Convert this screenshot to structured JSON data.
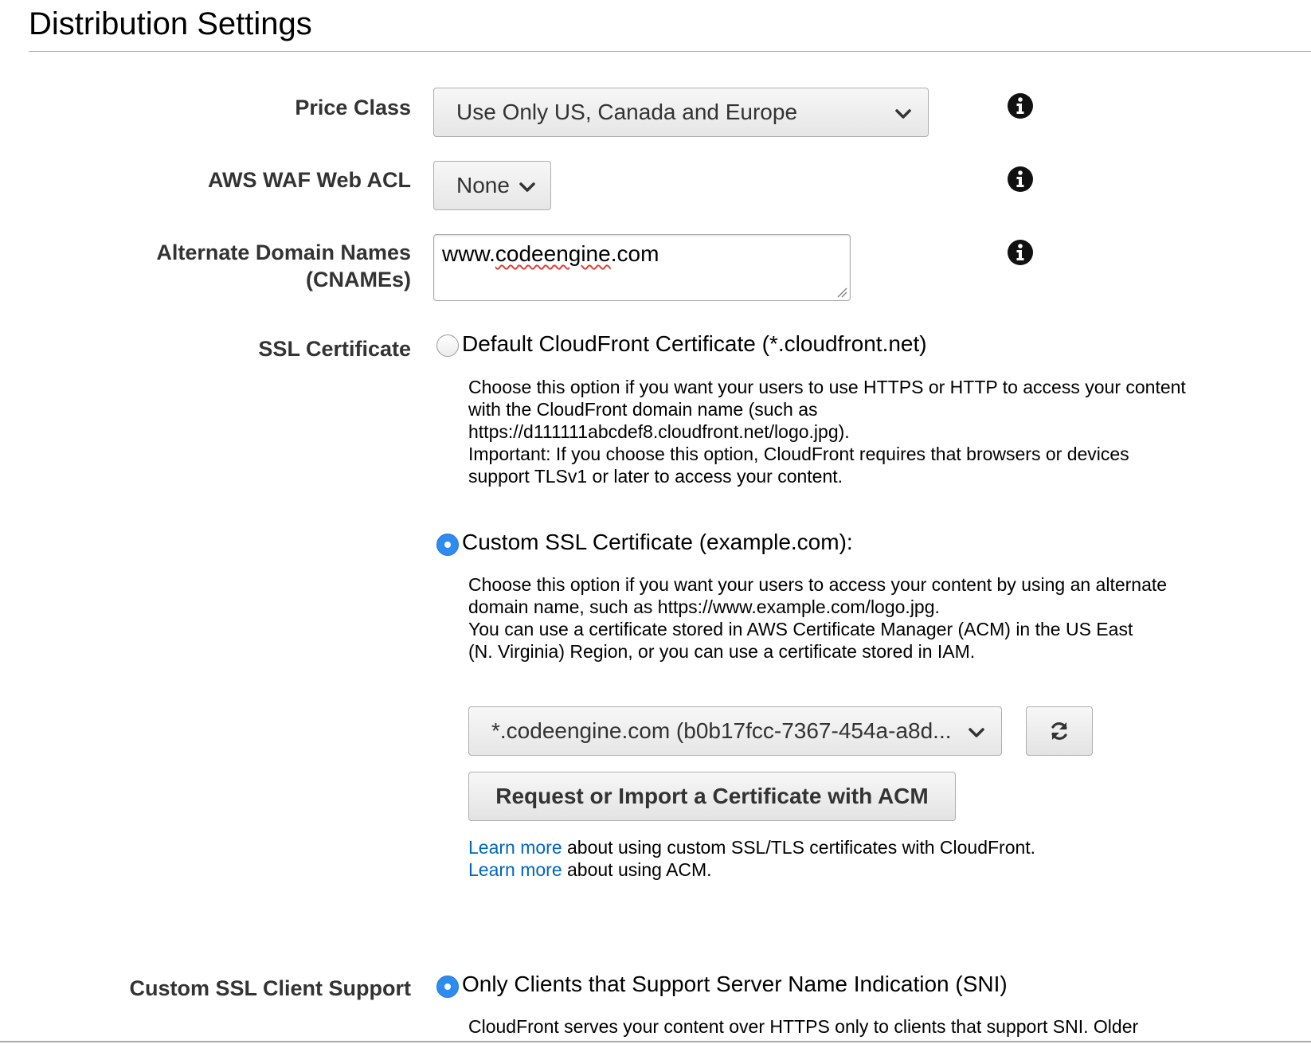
{
  "header": {
    "title": "Distribution Settings"
  },
  "price_class": {
    "label": "Price Class",
    "selected": "Use Only US, Canada and Europe"
  },
  "waf": {
    "label": "AWS WAF Web ACL",
    "selected": "None"
  },
  "cnames": {
    "label_line1": "Alternate Domain Names",
    "label_line2": "(CNAMEs)",
    "value_part1": "www.",
    "value_part2": "codeengine",
    "value_part3": ".com"
  },
  "ssl": {
    "label": "SSL Certificate",
    "default_option": {
      "label": "Default CloudFront Certificate (*.cloudfront.net)",
      "selected": false,
      "description": [
        "Choose this option if you want your users to use HTTPS or HTTP to access your content",
        "with the CloudFront domain name (such as",
        "https://d111111abcdef8.cloudfront.net/logo.jpg).",
        "Important: If you choose this option, CloudFront requires that browsers or devices",
        "support TLSv1 or later to access your content."
      ]
    },
    "custom_option": {
      "label": "Custom SSL Certificate (example.com):",
      "selected": true,
      "description": [
        "Choose this option if you want your users to access your content by using an alternate",
        "domain name, such as https://www.example.com/logo.jpg.",
        "You can use a certificate stored in AWS Certificate Manager (ACM) in the US East",
        "(N. Virginia) Region, or you can use a certificate stored in IAM."
      ],
      "certificate_selected": "*.codeengine.com (b0b17fcc-7367-454a-a8d...",
      "acm_button": "Request or Import a Certificate with ACM",
      "learn_more_1": {
        "link": "Learn more",
        "text": " about using custom SSL/TLS certificates with CloudFront."
      },
      "learn_more_2": {
        "link": "Learn more",
        "text": " about using ACM."
      }
    }
  },
  "client_support": {
    "label": "Custom SSL Client Support",
    "option_label": "Only Clients that Support Server Name Indication (SNI)",
    "selected": true,
    "description_line1": "CloudFront serves your content over HTTPS only to clients that support SNI. Older"
  },
  "icons": {
    "info": "info-icon",
    "dropdown": "chevron-down-icon",
    "refresh": "refresh-icon"
  },
  "colors": {
    "radio_selected": "#2e8cf0",
    "link": "#0066c0",
    "label": "#333333"
  }
}
